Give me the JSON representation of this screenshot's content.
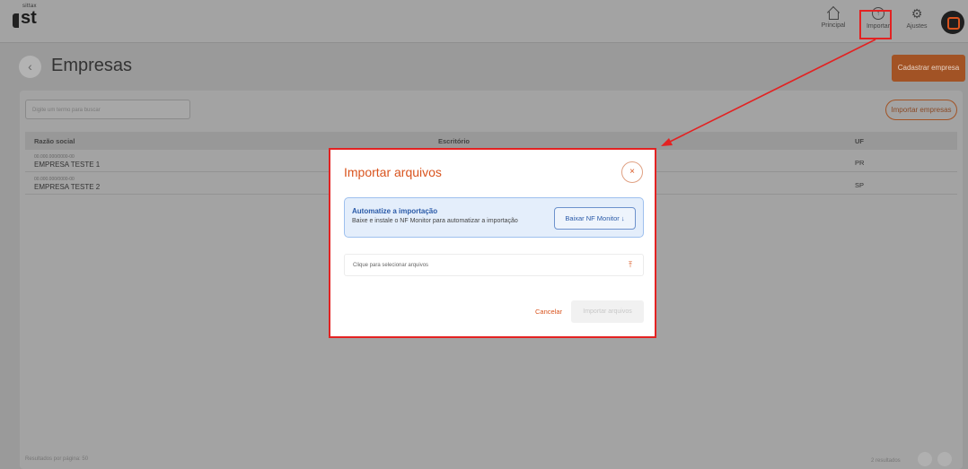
{
  "app": {
    "logo_small": "sittax",
    "logo_big": "st"
  },
  "nav": {
    "home": "Principal",
    "import": "Importar",
    "settings": "Ajustes"
  },
  "page": {
    "back": "‹",
    "title": "Empresas",
    "cadastrar": "Cadastrar empresa"
  },
  "toolbar": {
    "search_placeholder": "Digite um termo para buscar",
    "import_button": "Importar empresas"
  },
  "table": {
    "headers": [
      "Razão social",
      "Escritório",
      "UF"
    ],
    "rows": [
      {
        "cnpj": "00.000.000/0000-00",
        "name": "EMPRESA TESTE 1",
        "uf": "PR"
      },
      {
        "cnpj": "00.000.000/0000-00",
        "name": "EMPRESA TESTE 2",
        "uf": "SP"
      }
    ],
    "footer_left": "Resultados por página:  50",
    "footer_right": "2 resultados"
  },
  "modal": {
    "title": "Importar arquivos",
    "close": "×",
    "auto_title": "Automatize a importação",
    "auto_desc": "Baixe e instale o NF Monitor para automatizar a importação",
    "download_button": "Baixar NF Monitor  ↓",
    "file_placeholder": "Clique para selecionar arquivos",
    "upload_icon": "⤒",
    "cancel": "Cancelar",
    "import": "Importar arquivos"
  },
  "colors": {
    "accent": "#d9541e",
    "highlight": "#e32222",
    "info": "#2a5aa8"
  }
}
